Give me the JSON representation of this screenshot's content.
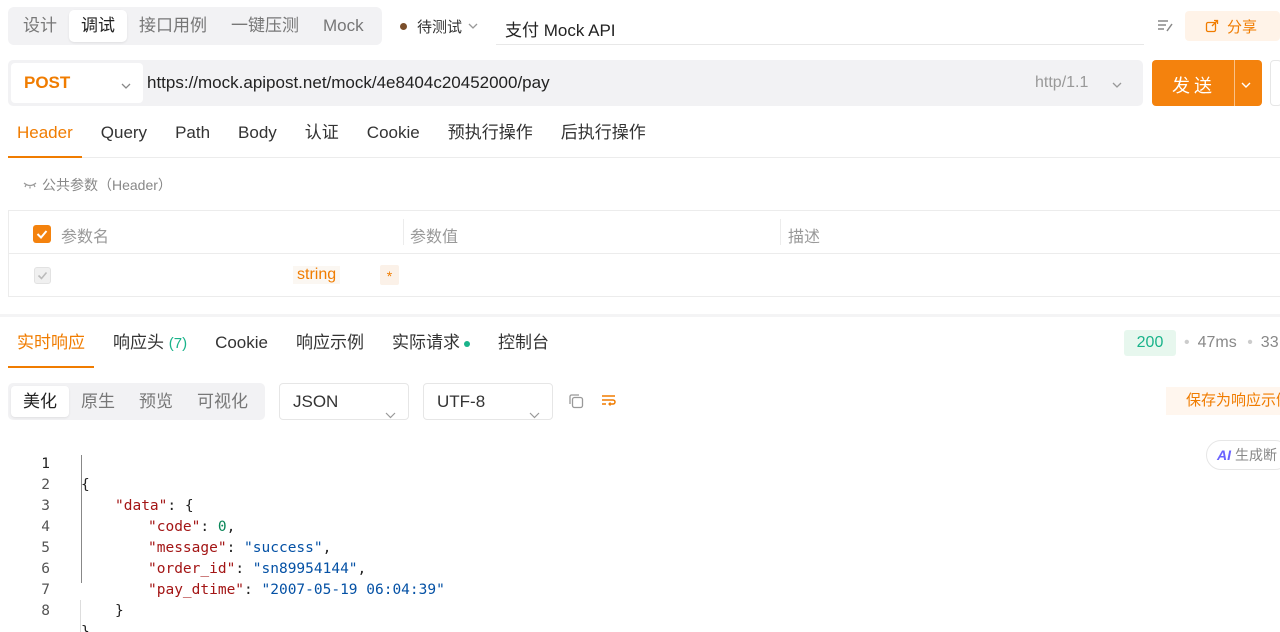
{
  "top_tabs": [
    "设计",
    "调试",
    "接口用例",
    "一键压测",
    "Mock"
  ],
  "status": {
    "label": "待测试"
  },
  "api_name": "支付 Mock API",
  "share_label": "分享",
  "request": {
    "method": "POST",
    "url": "https://mock.apipost.net/mock/4e8404c20452000/pay",
    "protocol": "http/1.1",
    "send_label": "发送"
  },
  "request_tabs": [
    "Header",
    "Query",
    "Path",
    "Body",
    "认证",
    "Cookie",
    "预执行操作",
    "后执行操作"
  ],
  "common_params_label": "公共参数（Header）",
  "param_table": {
    "headers": [
      "参数名",
      "参数值",
      "描述"
    ],
    "row": {
      "type": "string",
      "required": "*"
    }
  },
  "response_tabs": {
    "realtime": "实时响应",
    "headers": "响应头",
    "headers_count": "(7)",
    "cookie": "Cookie",
    "example": "响应示例",
    "actual": "实际请求",
    "console": "控制台"
  },
  "response_meta": {
    "status_code": "200",
    "time": "47ms",
    "size": "33"
  },
  "view_modes": [
    "美化",
    "原生",
    "预览",
    "可视化"
  ],
  "format": "JSON",
  "encoding": "UTF-8",
  "save_example_label": "保存为响应示例",
  "ai_button_label": "生成断",
  "ai_prefix": "AI",
  "code_lines": [
    "1",
    "2",
    "3",
    "4",
    "5",
    "6",
    "7",
    "8"
  ],
  "response_body": {
    "code_key": "\"code\"",
    "code_val": "0",
    "message_key": "\"message\"",
    "message_val": "\"success\"",
    "order_key": "\"order_id\"",
    "order_val": "\"sn89954144\"",
    "pay_key": "\"pay_dtime\"",
    "pay_val": "\"2007-05-19 06:04:39\"",
    "data_key": "\"data\""
  },
  "colors": {
    "accent": "#f4820d",
    "success": "#19b38a"
  }
}
